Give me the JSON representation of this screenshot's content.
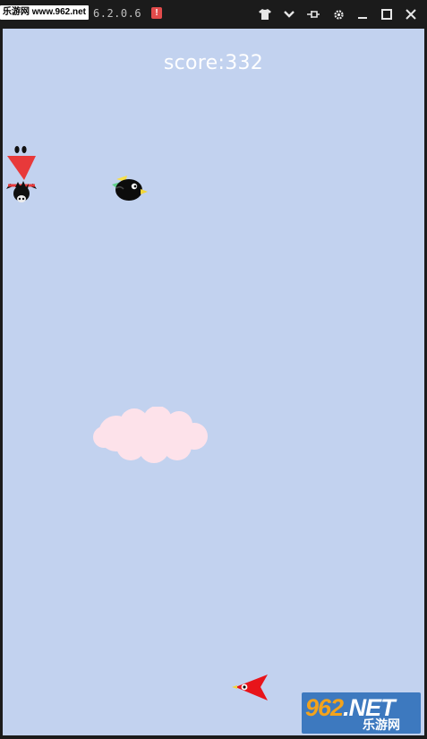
{
  "titlebar": {
    "watermark_text": "乐游网 www.962.net",
    "version_text": "6.2.0.6",
    "alert_badge": "!",
    "icons": [
      "shirt-icon",
      "chevron-down-icon",
      "pin-icon",
      "gear-icon",
      "minimize-icon",
      "maximize-icon",
      "close-icon"
    ]
  },
  "game": {
    "score_text": "score:332",
    "background_color": "#c2d2ef",
    "sprites": [
      "enemy-bird-hanging",
      "black-bird",
      "pink-cloud",
      "red-arrow-bird"
    ]
  },
  "logo": {
    "brand_prefix": "962",
    "brand_suffix": ".NET",
    "subtitle": "乐游网"
  }
}
